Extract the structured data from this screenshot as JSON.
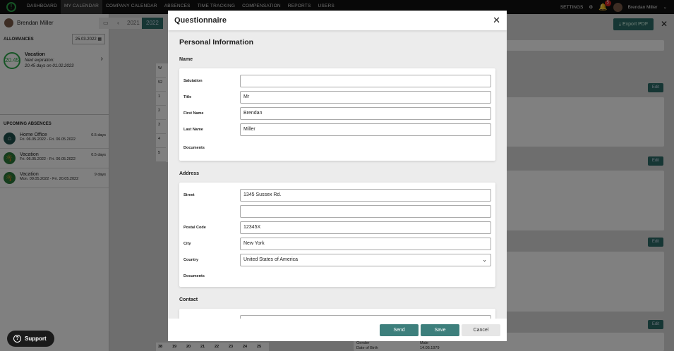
{
  "nav": {
    "items": [
      "DASHBOARD",
      "MY CALENDAR",
      "COMPANY CALENDAR",
      "ABSENCES",
      "TIME TRACKING",
      "COMPENSATION",
      "REPORTS",
      "USERS"
    ],
    "settings": "SETTINGS",
    "notifications": "5",
    "user": "Brendan Miller"
  },
  "sidebar": {
    "user": "Brendan Miller",
    "allowances_title": "ALLOWANCES",
    "date": "25.03.2022",
    "allowance": {
      "value": "20.45",
      "name": "Vacation",
      "line1": "Next expiration:",
      "line2": "20.45 days on 01.02.2023"
    },
    "upcoming_title": "UPCOMING ABSENCES",
    "absences": [
      {
        "name": "Home Office",
        "dates": "Fri. 06.05.2022 - Fri. 06.05.2022",
        "days": "0.5 days"
      },
      {
        "name": "Vacation",
        "dates": "Fri. 06.05.2022 - Fri. 06.05.2022",
        "days": "0.5 days"
      },
      {
        "name": "Vacation",
        "dates": "Mon. 09.05.2022 - Fri. 20.05.2022",
        "days": "9 days"
      }
    ]
  },
  "main": {
    "years": [
      "2021",
      "2022"
    ],
    "export": "Export PDF",
    "edit": "Edit",
    "week_header": "W",
    "weeks": [
      "52",
      "1",
      "2",
      "3",
      "4",
      "5"
    ],
    "week38": [
      "38",
      "19",
      "20",
      "21",
      "22",
      "23",
      "24",
      "25"
    ],
    "gender_label": "Gender",
    "gender": "Male",
    "dob_label": "Date of Birth",
    "dob": "14.05.1979"
  },
  "modal": {
    "title": "Questionnaire",
    "section": "Personal Information",
    "name": {
      "title": "Name",
      "salutation_label": "Salutation",
      "salutation": "",
      "title_label": "Title",
      "title_value": "Mr",
      "first_label": "First Name",
      "first": "Brendan",
      "last_label": "Last Name",
      "last": "Miller",
      "documents": "Documents"
    },
    "address": {
      "title": "Address",
      "street_label": "Street",
      "street": "1345 Sussex Rd.",
      "street2": "",
      "postal_label": "Postal Code",
      "postal": "12345X",
      "city_label": "City",
      "city": "New York",
      "country_label": "Country",
      "country": "United States of America",
      "documents": "Documents"
    },
    "contact": {
      "title": "Contact"
    },
    "send": "Send",
    "save": "Save",
    "cancel": "Cancel"
  },
  "support": "Support"
}
